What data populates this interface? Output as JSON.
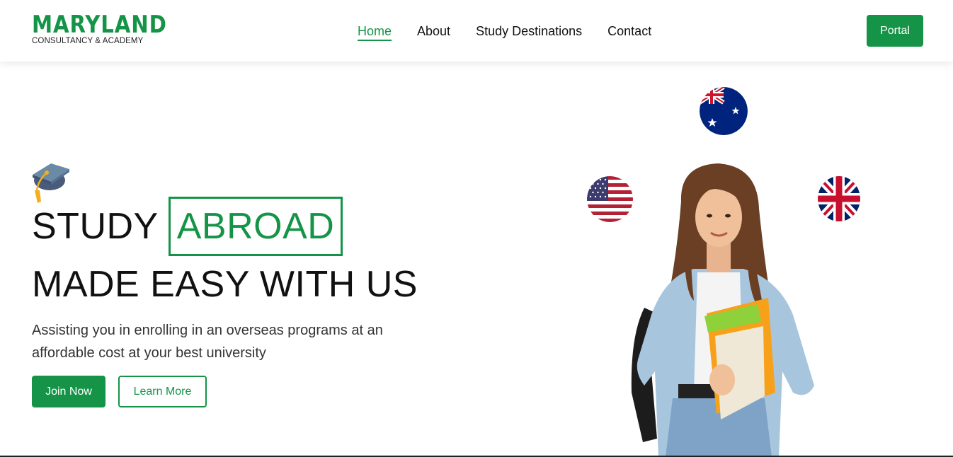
{
  "header": {
    "logo_main": "MARYLAND",
    "logo_sub": "CONSULTANCY & ACADEMY",
    "nav": [
      "Home",
      "About",
      "Study Destinations",
      "Contact"
    ],
    "active_nav": "Home",
    "portal_label": "Portal"
  },
  "hero": {
    "title_part1": "STUDY",
    "title_highlight": "ABROAD",
    "title_line2": "MADE EASY WITH US",
    "description": "Assisting you in enrolling in an overseas programs at an affordable cost at your best university",
    "join_label": "Join Now",
    "learn_label": "Learn More"
  },
  "icons": [
    "graduation-cap-icon",
    "australia-flag-icon",
    "usa-flag-icon",
    "uk-flag-icon"
  ],
  "colors": {
    "brand_green": "#159447",
    "text_dark": "#111111",
    "background": "#ffffff"
  }
}
